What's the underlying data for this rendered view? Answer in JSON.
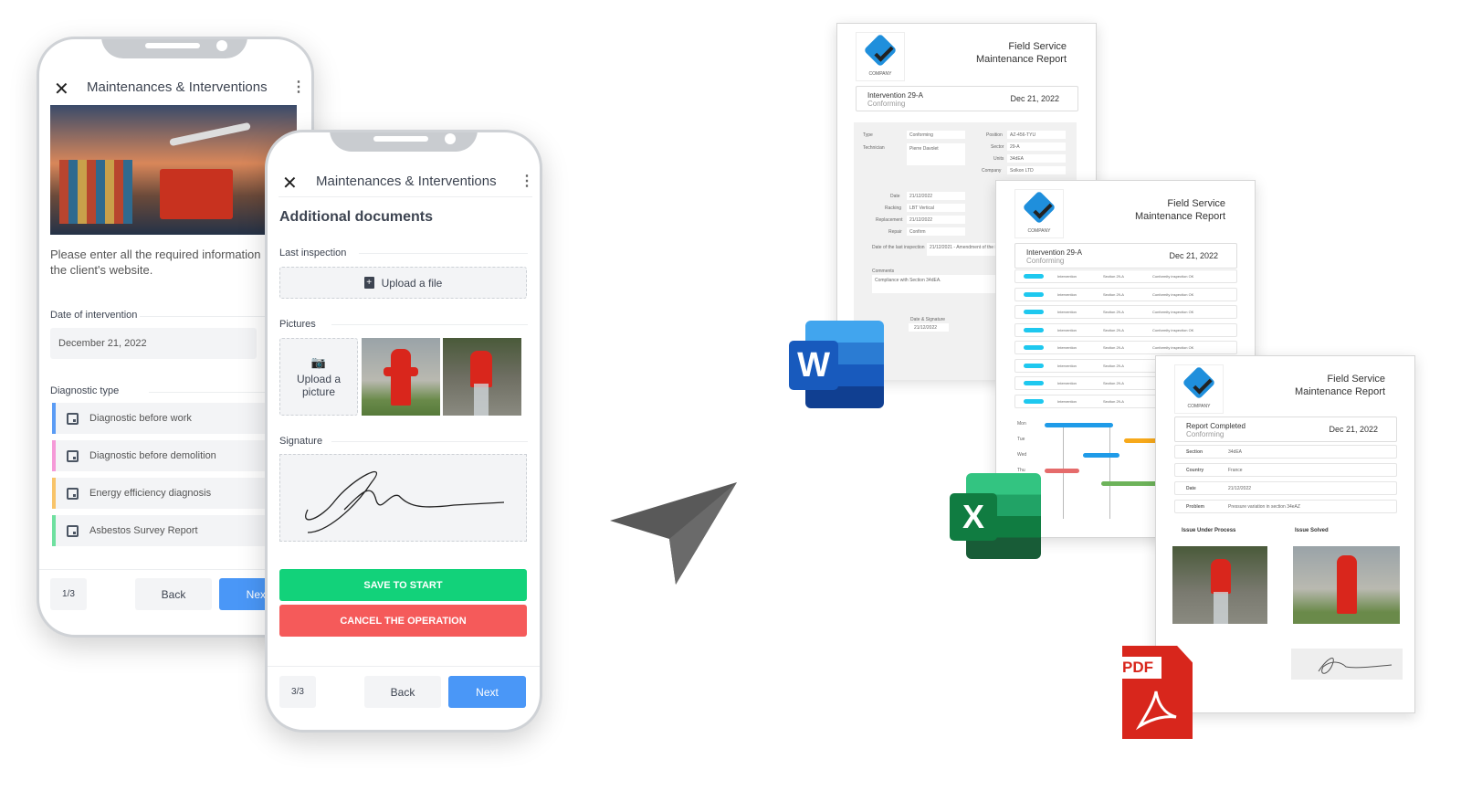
{
  "phone1": {
    "title": "Maintenances & Interventions",
    "intro": "Please enter all the required information the client's website.",
    "date_label": "Date of intervention",
    "date_value": "December 21, 2022",
    "diag_label": "Diagnostic type",
    "diagnostics": [
      {
        "label": "Diagnostic before work",
        "color": "#5b9cf5"
      },
      {
        "label": "Diagnostic before demolition",
        "color": "#f59ad8"
      },
      {
        "label": "Energy efficiency diagnosis",
        "color": "#f8c46a"
      },
      {
        "label": "Asbestos Survey Report",
        "color": "#6fe0a0"
      }
    ],
    "step": "1/3",
    "back": "Back",
    "next": "Next"
  },
  "phone2": {
    "title": "Maintenances & Interventions",
    "heading": "Additional documents",
    "last_inspection": "Last inspection",
    "upload_file": "Upload a file",
    "pictures": "Pictures",
    "upload_picture": "Upload a picture",
    "signature": "Signature",
    "save": "SAVE TO START",
    "cancel": "CANCEL THE OPERATION",
    "step": "3/3",
    "back": "Back",
    "next": "Next"
  },
  "colors": {
    "green": "#12d27a",
    "red": "#f55a5a",
    "blue": "#4a97f7"
  },
  "report": {
    "title1": "Field Service",
    "title2": "Maintenance Report",
    "company": "COMPANY",
    "date": "Dec 21, 2022"
  },
  "doc1": {
    "intervention": "Intervention 29-A",
    "status": "Conforming",
    "fields_left": [
      [
        "Type",
        "Conforming"
      ],
      [
        "Technician",
        "Pierre Davolet"
      ]
    ],
    "fields_right": [
      [
        "Position",
        "AZ-456-TYU"
      ],
      [
        "Sector",
        "29-A"
      ],
      [
        "Units",
        "34dEA"
      ],
      [
        "Company",
        "Solkon LTD"
      ]
    ],
    "fields_mid": [
      [
        "Date",
        "21/12/2022"
      ],
      [
        "Racking",
        "LBT Vertical"
      ],
      [
        "Replacement",
        "21/12/2022"
      ],
      [
        "Repair",
        "Confirm"
      ]
    ],
    "last_inspection_label": "Date of the last inspection",
    "last_inspection_value": "21/12/2021 - Amendment of the ir",
    "comments_label": "Comments",
    "comments_value": "Compliance with Section 34dEA.",
    "signature_label": "Date & Signature",
    "signature_date": "21/12/2022"
  },
  "doc2": {
    "intervention": "Intervention 29-A",
    "status": "Conforming",
    "rows": [
      [
        "Intervention",
        "Section 29-A",
        "Conformity inspection OK"
      ],
      [
        "Intervention",
        "Section 29-A",
        "Conformity inspection OK"
      ],
      [
        "Intervention",
        "Section 29-A",
        "Conformity inspection OK"
      ],
      [
        "Intervention",
        "Section 29-A",
        "Conformity inspection OK"
      ],
      [
        "Intervention",
        "Section 29-A",
        "Conformity inspection OK"
      ],
      [
        "Intervention",
        "Section 29-A",
        ""
      ],
      [
        "Intervention",
        "Section 29-A",
        ""
      ],
      [
        "Intervention",
        "Section 29-A",
        ""
      ]
    ],
    "gantt_labels": [
      "Mon",
      "Tue",
      "Wed",
      "Thu"
    ]
  },
  "doc3": {
    "intervention": "Report Completed",
    "status": "Conforming",
    "fields": [
      [
        "Section",
        "34dEA"
      ],
      [
        "Country",
        "France"
      ],
      [
        "Date",
        "21/12/2022"
      ],
      [
        "Problem",
        "Pressure variation in section 34eAZ"
      ]
    ],
    "issue_process": "Issue Under Process",
    "issue_solved": "Issue Solved"
  },
  "icons": {
    "word": "W",
    "excel": "X",
    "pdf": "PDF",
    "send": "paper-plane-icon"
  }
}
